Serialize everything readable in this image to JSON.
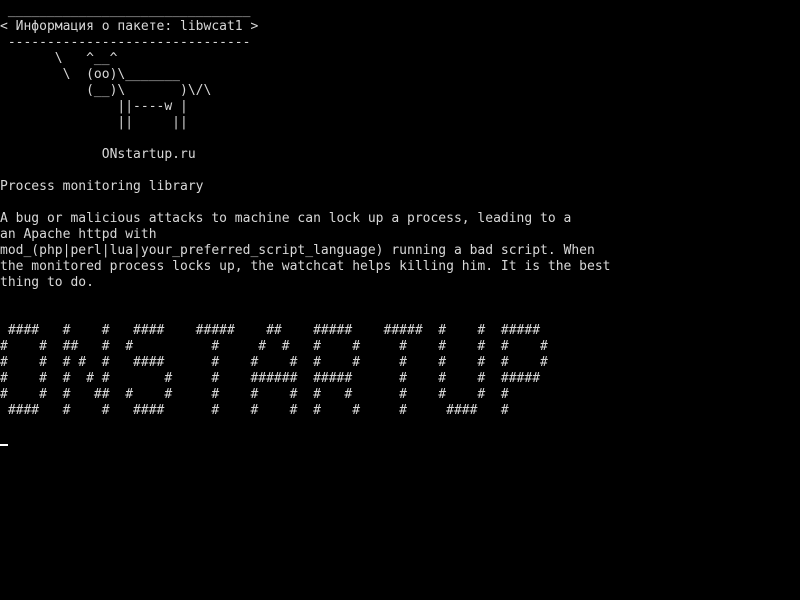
{
  "colors": {
    "background": "#000000",
    "text": "#d8d8d8",
    "cursor": "#ffffff"
  },
  "terminal": {
    "speech_bubble": {
      "top_border": " _______________________________",
      "text": "< Информация о пакете: libwcat1 >",
      "bottom_border": " -------------------------------"
    },
    "cow_art": [
      "       \\   ^__^",
      "        \\  (oo)\\_______",
      "           (__)\\       )\\/\\",
      "               ||----w |",
      "               ||     ||"
    ],
    "site_name": "             ONstartup.ru",
    "package_summary": "Process monitoring library",
    "description": [
      "A bug or malicious attacks to machine can lock up a process, leading to a",
      "an Apache httpd with",
      "mod_(php|perl|lua|your_preferred_script_language) running a bad script. When",
      "the monitored process locks up, the watchcat helps killing him. It is the best",
      "thing to do."
    ],
    "banner_art": [
      " ####   #    #   ####    #####    ##    #####    #####  #    #  #####",
      "#    #  ##   #  #          #     #  #   #    #     #    #    #  #    #",
      "#    #  # #  #   ####      #    #    #  #    #     #    #    #  #    #",
      "#    #  #  # #       #     #    ######  #####      #    #    #  #####",
      "#    #  #   ##  #    #     #    #    #  #   #      #    #    #  #",
      " ####   #    #   ####      #    #    #  #    #     #     ####   #"
    ]
  }
}
